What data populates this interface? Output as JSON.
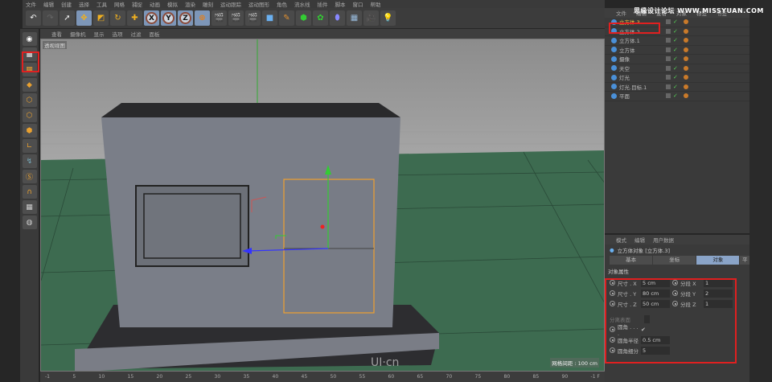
{
  "menu": [
    "文件",
    "编辑",
    "创建",
    "选择",
    "工具",
    "网格",
    "捕捉",
    "动画",
    "模拟",
    "渲染",
    "雕刻",
    "运动跟踪",
    "运动图形",
    "角色",
    "流水线",
    "插件",
    "脚本",
    "窗口",
    "帮助"
  ],
  "toolbar": {
    "axes": [
      "X",
      "Y",
      "Z"
    ]
  },
  "viewport": {
    "menu": [
      "查看",
      "摄像机",
      "显示",
      "选项",
      "过滤",
      "面板"
    ],
    "label": "透视视图",
    "grid_spacing": "网格间距 : 100 cm",
    "watermark": "UI·cn"
  },
  "timeline": {
    "ticks": [
      "-1",
      "5",
      "10",
      "15",
      "20",
      "25",
      "30",
      "35",
      "40",
      "45",
      "50",
      "55",
      "60",
      "65",
      "70",
      "75",
      "80",
      "85",
      "90"
    ],
    "end": "-1 F"
  },
  "object_manager": {
    "menu": [
      "文件",
      "编辑",
      "查看",
      "对象",
      "标签",
      "书签"
    ],
    "objects": [
      {
        "name": "立方体.3",
        "selected": true
      },
      {
        "name": "立方体.2"
      },
      {
        "name": "立方体.1"
      },
      {
        "name": "立方体"
      },
      {
        "name": "摄像"
      },
      {
        "name": "天空"
      },
      {
        "name": "灯光"
      },
      {
        "name": "灯光.目标.1"
      },
      {
        "name": "平面"
      }
    ]
  },
  "attributes": {
    "menu": [
      "模式",
      "编辑",
      "用户数据"
    ],
    "title": "立方体对象 [立方体.3]",
    "tabs": [
      "基本",
      "坐标",
      "对象",
      "平"
    ],
    "active_tab": "对象",
    "section": "对象属性",
    "size": [
      {
        "label": "尺寸 . X",
        "value": "5 cm"
      },
      {
        "label": "尺寸 . Y",
        "value": "80 cm"
      },
      {
        "label": "尺寸 . Z",
        "value": "50 cm"
      }
    ],
    "segments": [
      {
        "label": "分段 X",
        "value": "1"
      },
      {
        "label": "分段 Y",
        "value": "2"
      },
      {
        "label": "分段 Z",
        "value": "1"
      }
    ],
    "separate_surfaces": "分离表面",
    "fillet": "圆角 . . . .",
    "fillet_check": "✔",
    "fillet_radius": {
      "label": "圆角半径",
      "value": "0.5 cm"
    },
    "fillet_subdiv": {
      "label": "圆角细分",
      "value": "5"
    }
  },
  "site_watermark": "思缘设计论坛  WWW.MISSYUAN.COM",
  "colors": {
    "highlight": "#e02020",
    "accent": "#8aa4c8",
    "floor": "#3d6b50"
  }
}
